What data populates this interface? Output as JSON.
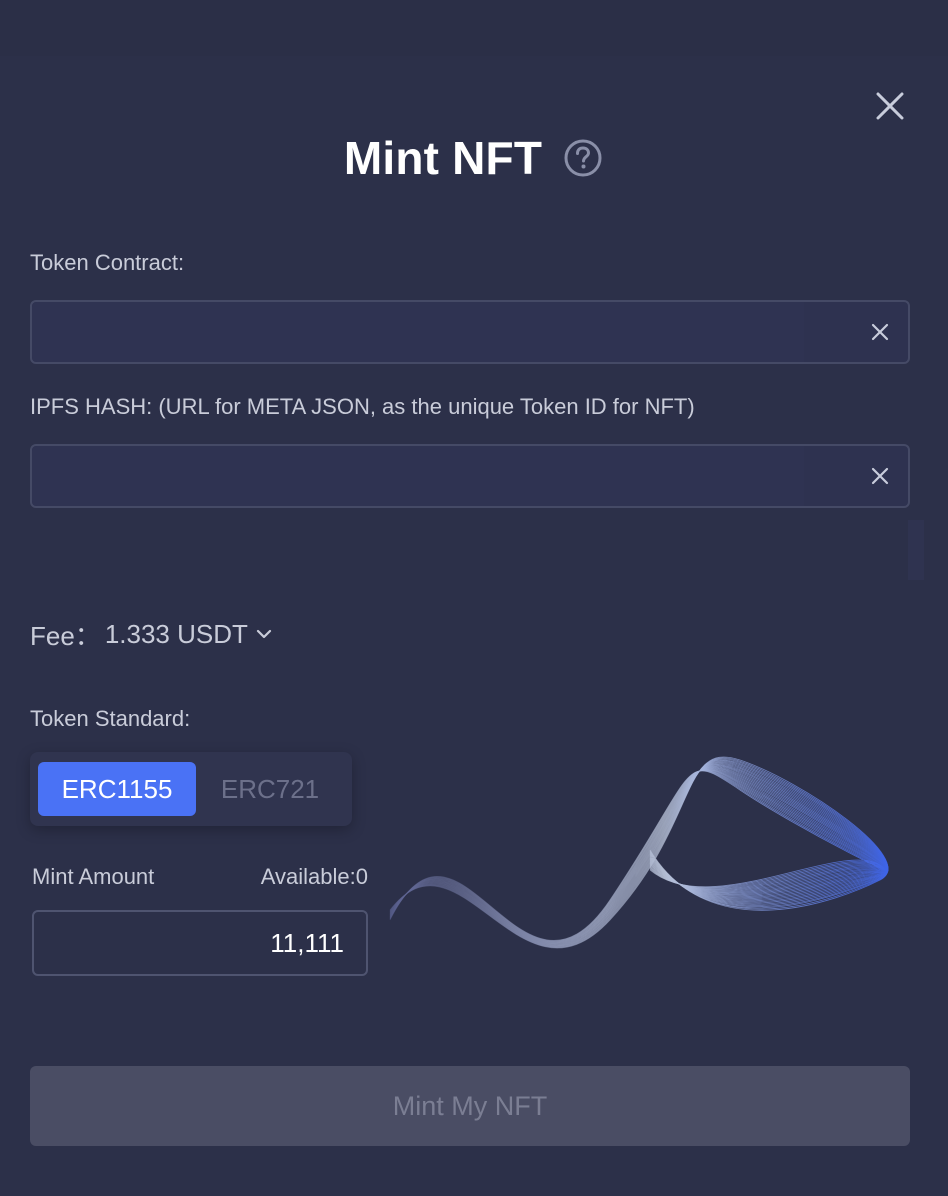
{
  "modal": {
    "title": "Mint NFT",
    "colors": {
      "background": "#2c3049",
      "accent": "#4a72f5",
      "disabled_button": "#4a4d64"
    }
  },
  "form": {
    "token_contract": {
      "label": "Token Contract:",
      "value": ""
    },
    "ipfs_hash": {
      "label": "IPFS HASH: (URL for META JSON, as the unique Token ID for NFT)",
      "value": ""
    },
    "fee": {
      "label": "Fee：",
      "value": "1.333 USDT"
    },
    "token_standard": {
      "label": "Token Standard:",
      "options": [
        "ERC1155",
        "ERC721"
      ],
      "selected": "ERC1155"
    },
    "mint_amount": {
      "label": "Mint Amount",
      "available": "Available:0",
      "value": "11,111"
    }
  },
  "actions": {
    "submit_label": "Mint My NFT"
  },
  "icons": {
    "close": "close-icon",
    "help": "question-circle-icon",
    "clear": "clear-icon",
    "dropdown": "chevron-down-icon"
  }
}
